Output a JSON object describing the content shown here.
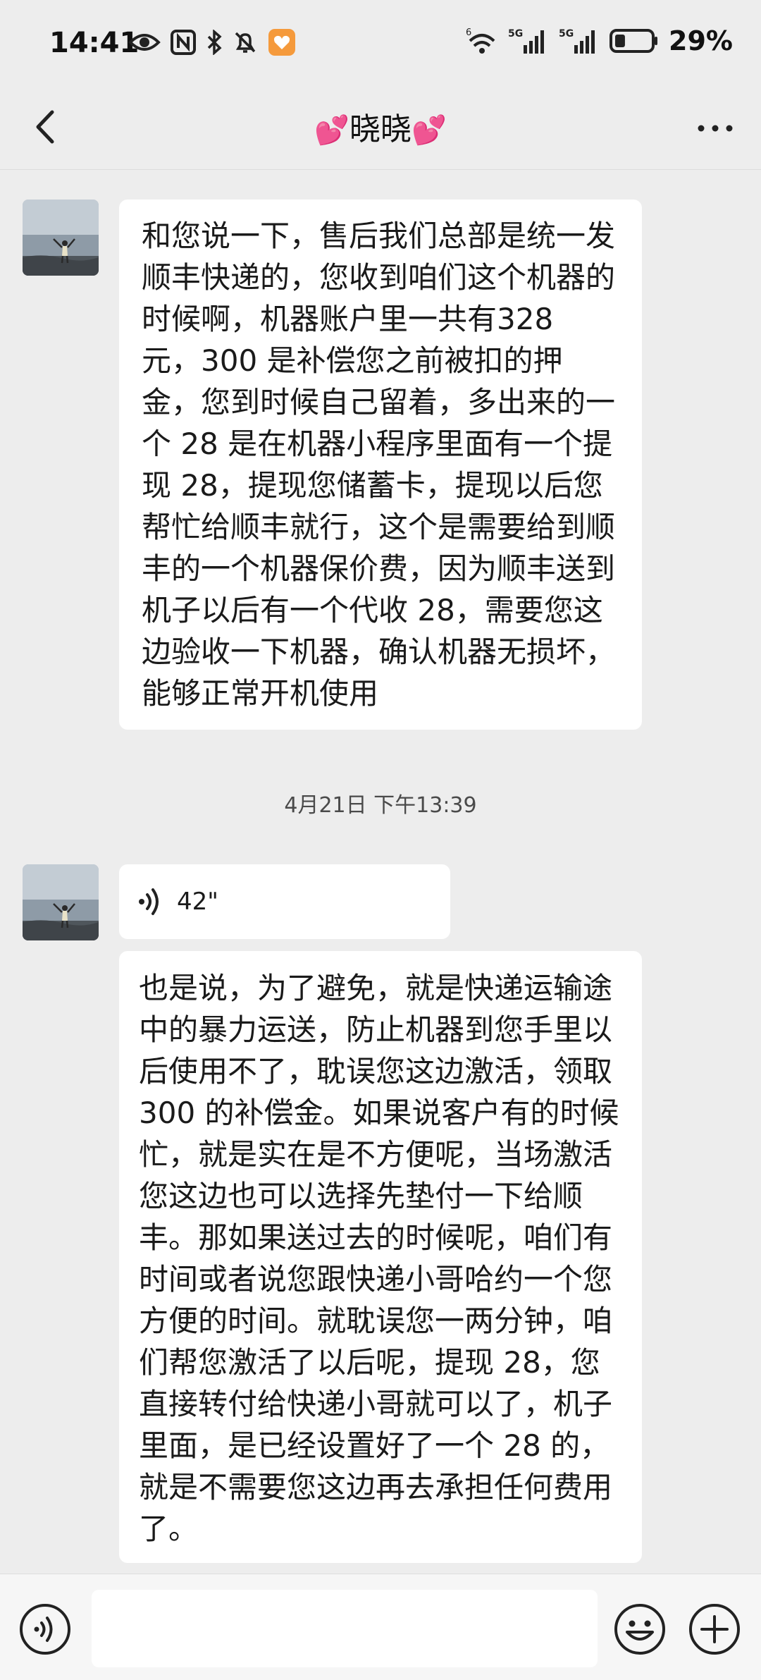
{
  "status_bar": {
    "time": "14:41",
    "battery_percent": "29%",
    "battery_level": 0.29,
    "signal_labels": [
      "6",
      "5G",
      "5G"
    ]
  },
  "nav": {
    "title": "晓晓",
    "title_emoji": "💕"
  },
  "messages": [
    {
      "type": "text",
      "text": "和您说一下，售后我们总部是统一发顺丰快递的，您收到咱们这个机器的时候啊，机器账户里一共有328 元，300 是补偿您之前被扣的押金，您到时候自己留着，多出来的一个 28 是在机器小程序里面有一个提现 28，提现您储蓄卡，提现以后您帮忙给顺丰就行，这个是需要给到顺丰的一个机器保价费，因为顺丰送到机子以后有一个代收 28，需要您这边验收一下机器，确认机器无损坏，能够正常开机使用"
    },
    {
      "type": "timestamp",
      "text": "4月21日 下午13:39"
    },
    {
      "type": "voice",
      "duration": "42\""
    },
    {
      "type": "text",
      "text": "也是说，为了避免，就是快递运输途中的暴力运送，防止机器到您手里以后使用不了，耽误您这边激活，领取 300 的补偿金。如果说客户有的时候忙，就是实在是不方便呢，当场激活您这边也可以选择先垫付一下给顺丰。那如果送过去的时候呢，咱们有时间或者说您跟快递小哥哈约一个您方便的时间。就耽误您一两分钟，咱们帮您激活了以后呢，提现 28，您直接转付给快递小哥就可以了，机子里面，是已经设置好了一个 28 的，就是不需要您这边再去承担任何费用了。"
    }
  ],
  "input": {
    "value": "",
    "placeholder": ""
  },
  "colors": {
    "background": "#ededed",
    "bubble": "#ffffff",
    "heart": "#e84a9a"
  }
}
